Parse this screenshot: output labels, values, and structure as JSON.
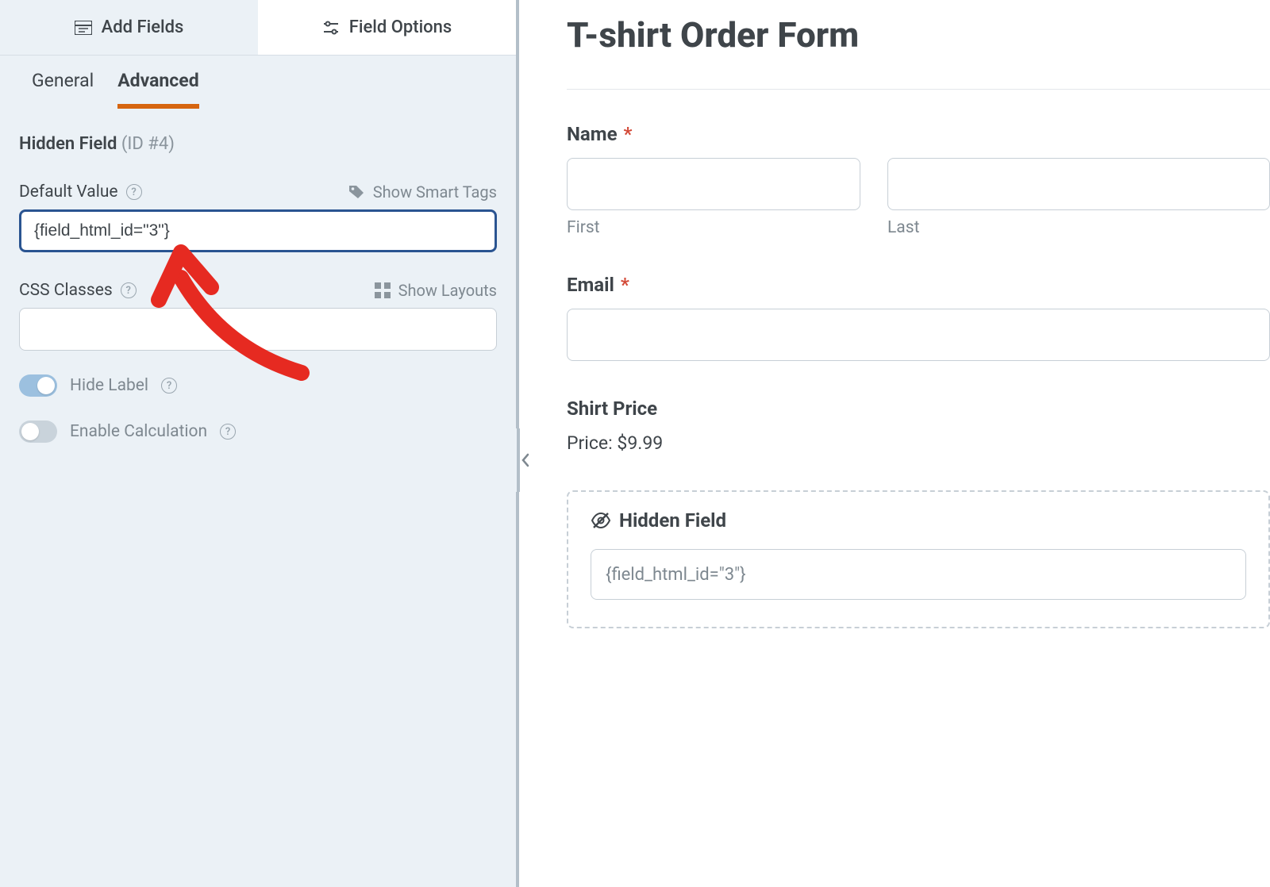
{
  "sidebar": {
    "tabs": {
      "add_fields": "Add Fields",
      "field_options": "Field Options"
    },
    "subtabs": {
      "general": "General",
      "advanced": "Advanced"
    },
    "heading": {
      "title": "Hidden Field",
      "id_label": "(ID #4)"
    },
    "default_value": {
      "label": "Default Value",
      "smart_tags": "Show Smart Tags",
      "value": "{field_html_id=\"3\"}"
    },
    "css_classes": {
      "label": "CSS Classes",
      "show_layouts": "Show Layouts",
      "value": ""
    },
    "hide_label": {
      "label": "Hide Label"
    },
    "enable_calc": {
      "label": "Enable Calculation"
    }
  },
  "preview": {
    "form_title": "T-shirt Order Form",
    "name": {
      "label": "Name",
      "first": "First",
      "last": "Last"
    },
    "email": {
      "label": "Email"
    },
    "shirt_price": {
      "label": "Shirt Price",
      "price_line": "Price: $9.99"
    },
    "hidden": {
      "label": "Hidden Field",
      "value": "{field_html_id=\"3\"}"
    }
  }
}
